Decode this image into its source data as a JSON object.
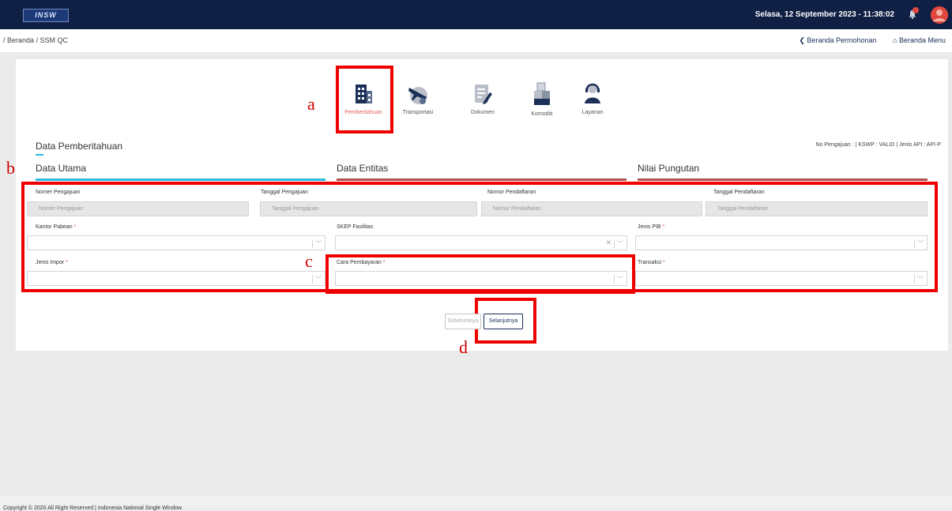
{
  "header": {
    "logo_text": "INSW",
    "datetime": "Selasa, 12 September 2023 - 11:38:02"
  },
  "breadcrumb": "/ Beranda / SSM QC",
  "subnav": {
    "beranda_permohonan": "❮ Beranda Permohonan",
    "beranda_menu": "⌂ Beranda Menu"
  },
  "steps": [
    {
      "label": "Pemberitahuan",
      "icon": "building-icon",
      "active": true
    },
    {
      "label": "Transportasi",
      "icon": "airplane-icon"
    },
    {
      "label": "Dokumen",
      "icon": "document-icon"
    },
    {
      "label": "Komoditi",
      "icon": "boxes-icon"
    },
    {
      "label": "Layanan",
      "icon": "customer-service-icon"
    }
  ],
  "section": {
    "title": "Data Pemberitahuan",
    "meta": "No Pengajuan : | KSWP : VALID | Jenis API : API-P"
  },
  "tabs": [
    "Data Utama",
    "Data Entitas",
    "Nilai Pungutan"
  ],
  "form": {
    "nomor_pengajuan": {
      "label": "Nomer Pengajuan",
      "placeholder": "Nomer Pengajuan"
    },
    "tanggal_pengajuan": {
      "label": "Tanggal Pengajuan",
      "placeholder": "Tanggal Pengajuan"
    },
    "nomor_pendaftaran": {
      "label": "Nomor Pendaftaran",
      "placeholder": "Nomor Pendaftaran"
    },
    "tanggal_pendaftaran": {
      "label": "Tanggal Pendaftaran",
      "placeholder": "Tanggal Pendaftaran"
    },
    "kantor_pabean": {
      "label": "Kantor Pabean"
    },
    "skep_fasilitas": {
      "label": "SKEP Fasilitas"
    },
    "jenis_pib": {
      "label": "Jenis PIB"
    },
    "jenis_impor": {
      "label": "Jenis Impor"
    },
    "cara_pembayaran": {
      "label": "Cara Pembayaran"
    },
    "transaksi": {
      "label": "Transaksi"
    },
    "required_mark": "*"
  },
  "buttons": {
    "prev": "Sebelumnya",
    "next": "Selanjutnya"
  },
  "annotations": {
    "a": "a",
    "b": "b",
    "c": "c",
    "d": "d"
  },
  "footer": "Copyright © 2020 All Right Reserved | Indonesia National Single Window",
  "colors": {
    "header_bg": "#0f2044",
    "annotation_red": "#ef0000",
    "tab_active": "#2bbbe0",
    "tab_inactive": "#b05050"
  }
}
